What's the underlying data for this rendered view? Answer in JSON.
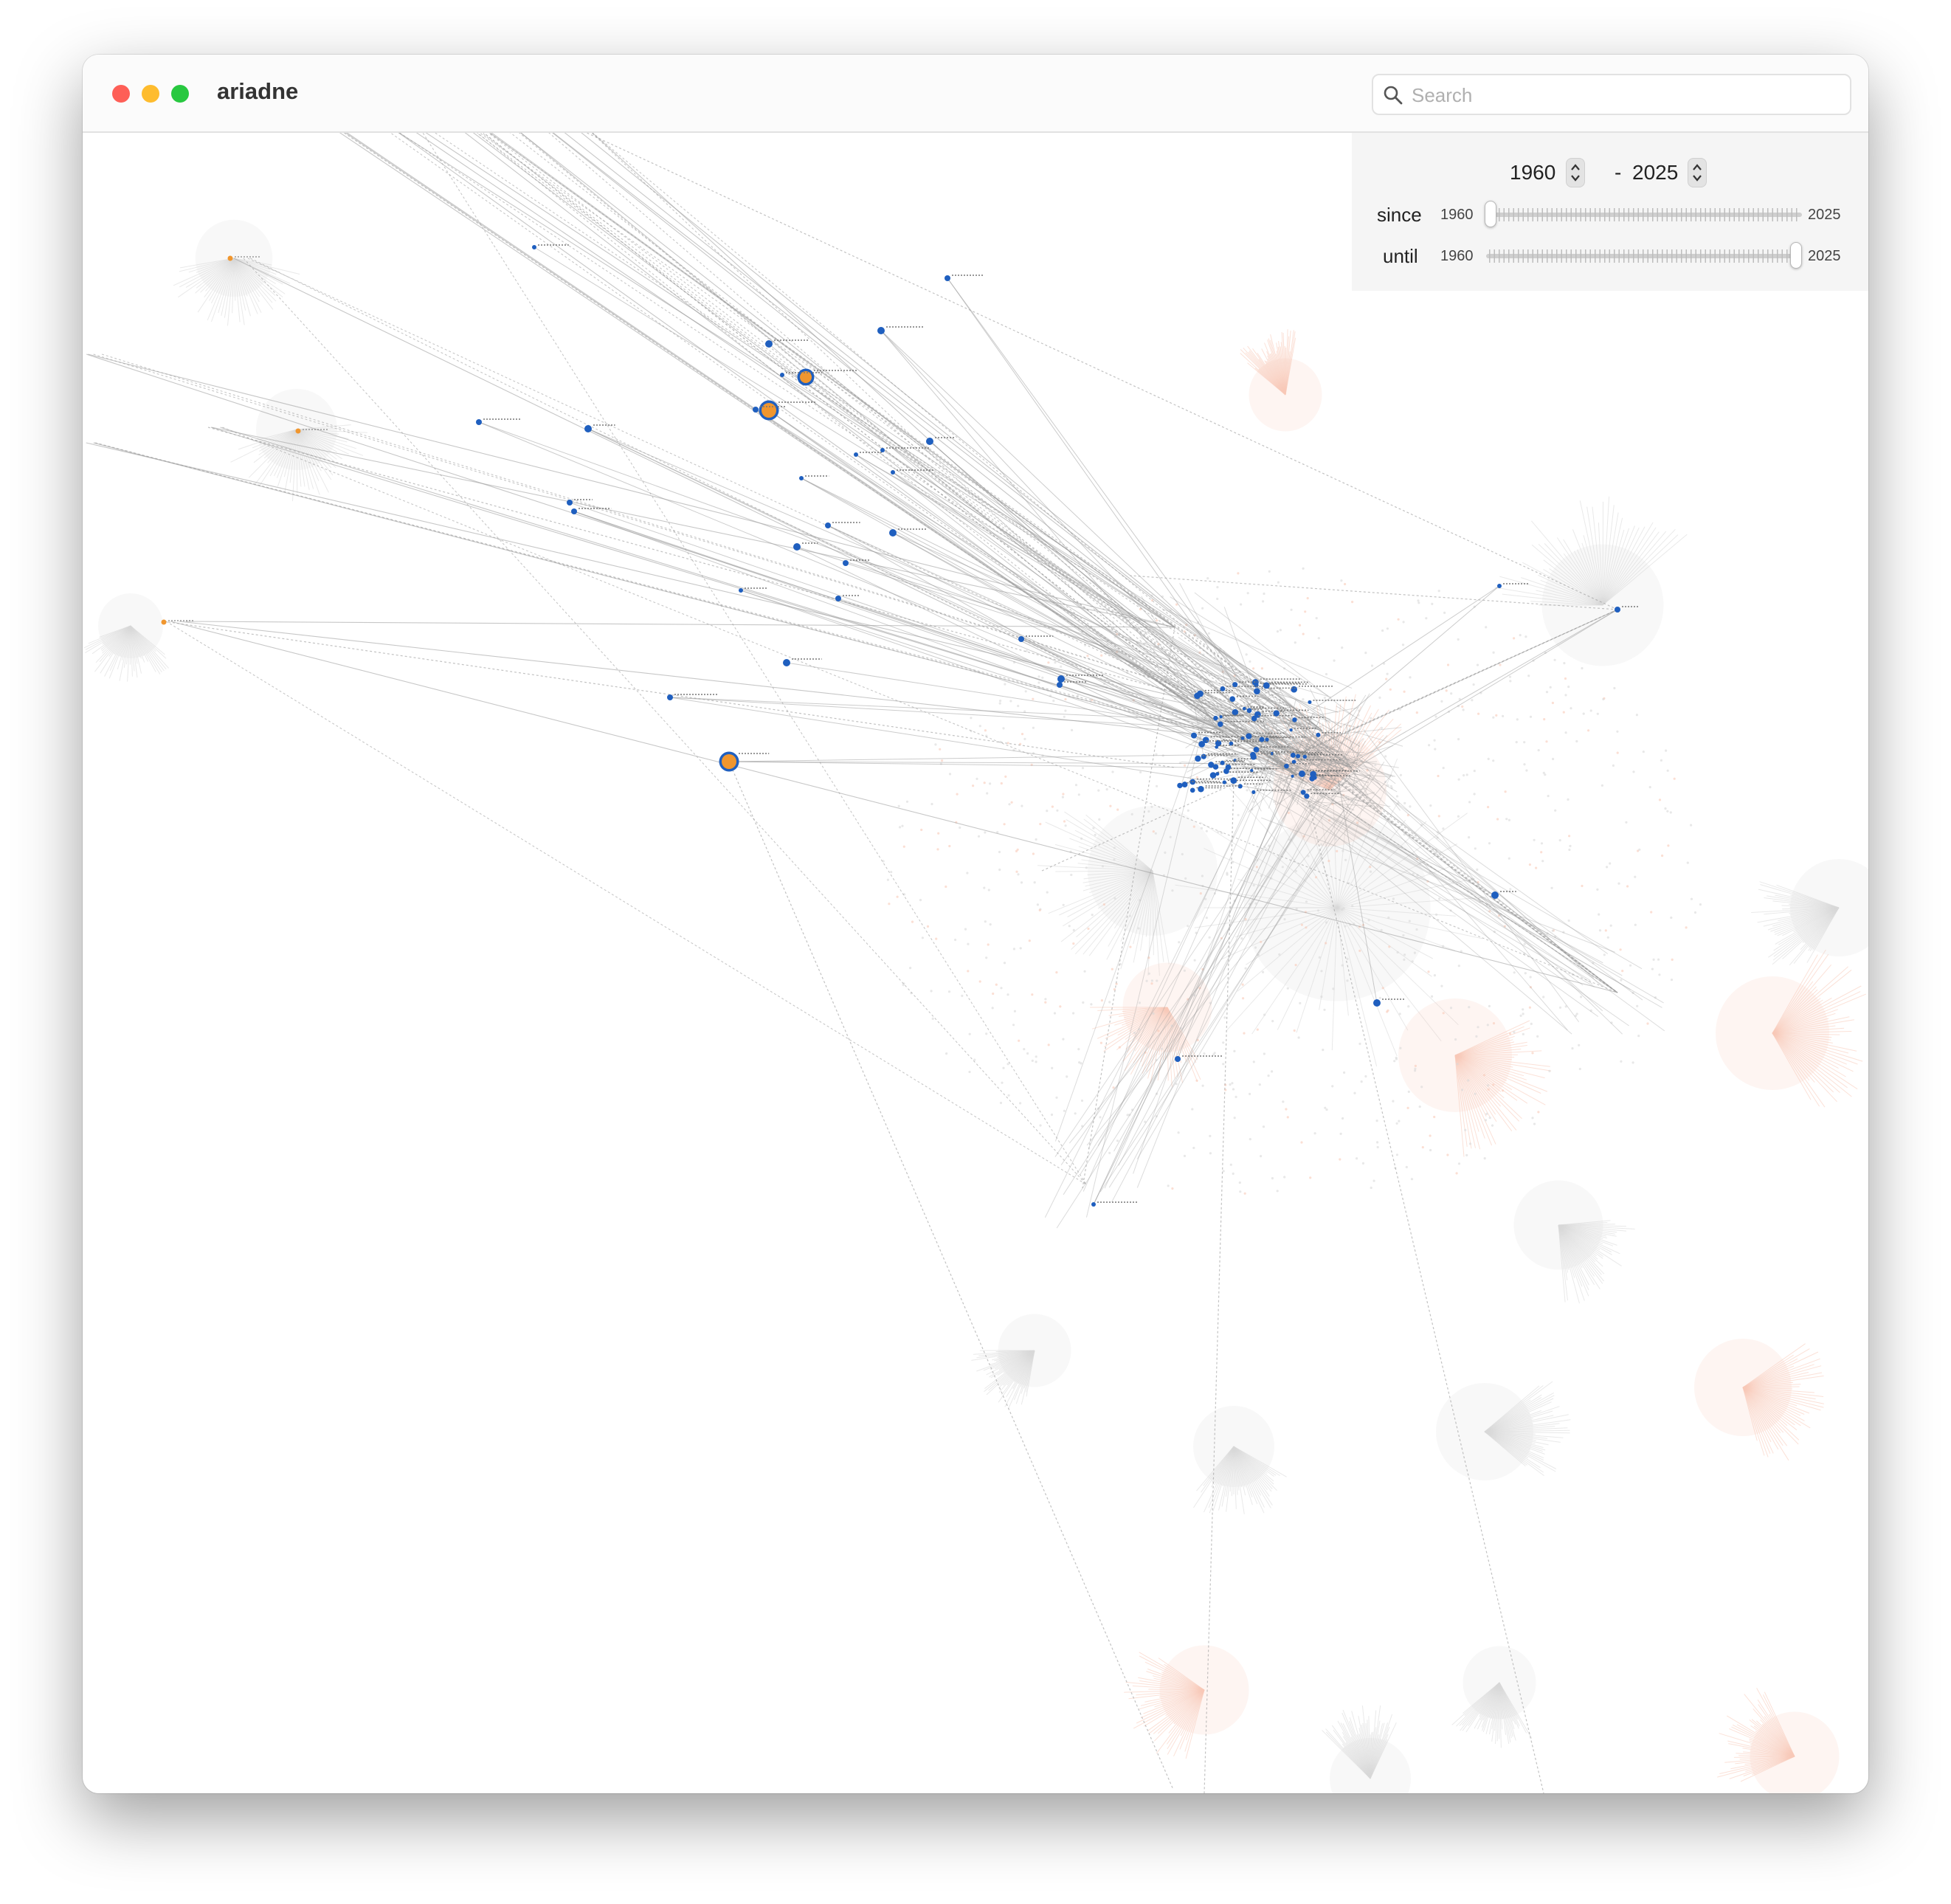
{
  "window": {
    "title": "ariadne"
  },
  "search": {
    "placeholder": "Search",
    "value": ""
  },
  "year_filter": {
    "from_year": "1960",
    "range_separator": "-",
    "to_year": "2025",
    "since": {
      "label": "since",
      "min_label": "1960",
      "max_label": "2025",
      "value_fraction": 0.0
    },
    "until": {
      "label": "until",
      "min_label": "1960",
      "max_label": "2025",
      "value_fraction": 1.0
    }
  },
  "colors": {
    "node_blue": "#1f5fbf",
    "node_orange": "#f0962e",
    "edge_gray": "#9a9a9a",
    "halo_gray": "#d8d8d8",
    "halo_peach": "#f8c9b8"
  },
  "icons": {
    "search": "search-icon",
    "stepper": "stepper-arrows-icon"
  }
}
